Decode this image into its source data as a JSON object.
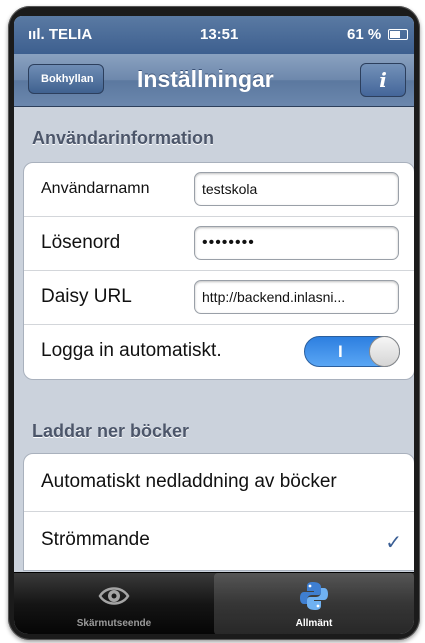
{
  "status_bar": {
    "carrier": "ııl. TELIA",
    "time": "13:51",
    "battery": "61 %"
  },
  "nav": {
    "back_label": "Bokhyllan",
    "title": "Inställningar",
    "info_label": "i"
  },
  "user_section": {
    "header": "Användarinformation",
    "username_label": "Användarnamn",
    "username_value": "testskola",
    "password_label": "Lösenord",
    "password_value": "••••••••",
    "url_label": "Daisy URL",
    "url_value": "http://backend.inlasni...",
    "autologin_label": "Logga in automatiskt.",
    "autologin_toggle_text": "I",
    "autologin_on": true
  },
  "download_section": {
    "header": "Laddar ner böcker",
    "options": [
      {
        "label": "Automatiskt nedladdning av böcker",
        "selected": false
      },
      {
        "label": "Strömmande",
        "selected": true
      }
    ],
    "check_mark": "✓"
  },
  "tab_bar": {
    "tabs": [
      {
        "label": "Skärmutseende",
        "icon": "eye-icon",
        "active": false
      },
      {
        "label": "Allmänt",
        "icon": "python-logo-icon",
        "active": true
      }
    ]
  },
  "colors": {
    "nav_blue": "#5b789f",
    "toggle_blue": "#2d7fe0",
    "check_blue": "#3a5e94"
  }
}
